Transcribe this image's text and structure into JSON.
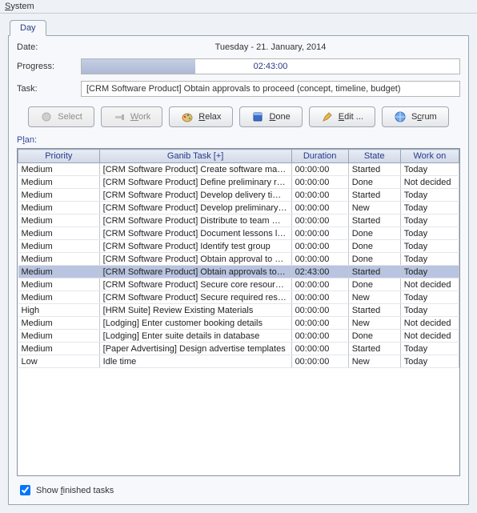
{
  "menu": {
    "system_label": "System",
    "system_accel": "S"
  },
  "tab": {
    "day_label": "Day"
  },
  "date": {
    "label": "Date:",
    "value": "Tuesday - 21. January, 2014"
  },
  "progress": {
    "label": "Progress:",
    "text": "02:43:00",
    "fill_pct": 30
  },
  "task": {
    "label": "Task:",
    "value": "[CRM Software Product] Obtain approvals to proceed (concept, timeline, budget)"
  },
  "buttons": {
    "select": "Select",
    "work": "Work",
    "relax": "Relax",
    "done": "Done",
    "edit": "Edit ...",
    "scrum": "Scrum"
  },
  "plan_label": "Plan:",
  "columns": {
    "priority": "Priority",
    "task": "Ganib Task [+]",
    "duration": "Duration",
    "state": "State",
    "workon": "Work on"
  },
  "rows": [
    {
      "priority": "Medium",
      "task": "[CRM Software Product] Create software maintenanc..",
      "duration": "00:00:00",
      "state": "Started",
      "workon": "Today",
      "selected": false
    },
    {
      "priority": "Medium",
      "task": "[CRM Software Product] Define preliminary resources",
      "duration": "00:00:00",
      "state": "Done",
      "workon": "Not decided",
      "selected": false
    },
    {
      "priority": "Medium",
      "task": "[CRM Software Product] Develop delivery timeline",
      "duration": "00:00:00",
      "state": "Started",
      "workon": "Today",
      "selected": false
    },
    {
      "priority": "Medium",
      "task": "[CRM Software Product] Develop preliminary budget",
      "duration": "00:00:00",
      "state": "New",
      "workon": "Today",
      "selected": false
    },
    {
      "priority": "Medium",
      "task": "[CRM Software Product] Distribute to team members",
      "duration": "00:00:00",
      "state": "Started",
      "workon": "Today",
      "selected": false
    },
    {
      "priority": "Medium",
      "task": "[CRM Software Product] Document lessons learned",
      "duration": "00:00:00",
      "state": "Done",
      "workon": "Today",
      "selected": false
    },
    {
      "priority": "Medium",
      "task": "[CRM Software Product] Identify test group",
      "duration": "00:00:00",
      "state": "Done",
      "workon": "Today",
      "selected": false
    },
    {
      "priority": "Medium",
      "task": "[CRM Software Product] Obtain approval to proceed",
      "duration": "00:00:00",
      "state": "Done",
      "workon": "Today",
      "selected": false
    },
    {
      "priority": "Medium",
      "task": "[CRM Software Product] Obtain approvals to proceed",
      "duration": "02:43:00",
      "state": "Started",
      "workon": "Today",
      "selected": true
    },
    {
      "priority": "Medium",
      "task": "[CRM Software Product] Secure core resources",
      "duration": "00:00:00",
      "state": "Done",
      "workon": "Not decided",
      "selected": false
    },
    {
      "priority": "Medium",
      "task": "[CRM Software Product] Secure required resources",
      "duration": "00:00:00",
      "state": "New",
      "workon": "Today",
      "selected": false
    },
    {
      "priority": "High",
      "task": "[HRM Suite] Review Existing Materials",
      "duration": "00:00:00",
      "state": "Started",
      "workon": "Today",
      "selected": false
    },
    {
      "priority": "Medium",
      "task": "[Lodging] Enter customer booking details",
      "duration": "00:00:00",
      "state": "New",
      "workon": "Not decided",
      "selected": false
    },
    {
      "priority": "Medium",
      "task": "[Lodging] Enter suite details in database",
      "duration": "00:00:00",
      "state": "Done",
      "workon": "Not decided",
      "selected": false
    },
    {
      "priority": "Medium",
      "task": "[Paper Advertising] Design advertise templates",
      "duration": "00:00:00",
      "state": "Started",
      "workon": "Today",
      "selected": false
    },
    {
      "priority": "Low",
      "task": "Idle time",
      "duration": "00:00:00",
      "state": "New",
      "workon": "Today",
      "selected": false
    }
  ],
  "show_finished": {
    "label": "Show finished tasks",
    "accel_char": "f",
    "checked": true
  }
}
